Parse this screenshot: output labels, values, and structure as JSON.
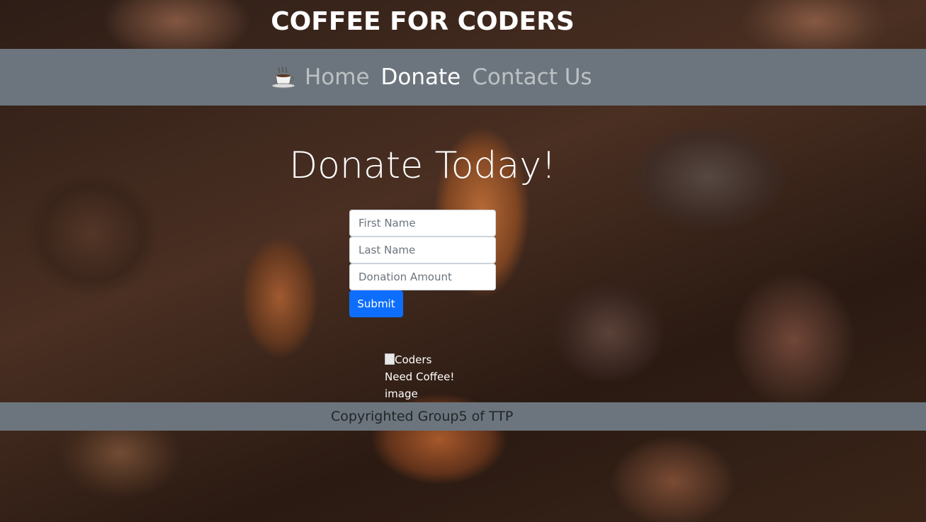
{
  "header": {
    "title": "COFFEE FOR CODERS"
  },
  "nav": {
    "brand_icon": "coffee-cup-icon",
    "links": [
      {
        "label": "Home",
        "active": false
      },
      {
        "label": "Donate",
        "active": true
      },
      {
        "label": "Contact Us",
        "active": false
      }
    ]
  },
  "main": {
    "heading": "Donate Today!",
    "form": {
      "first_name": {
        "value": "",
        "placeholder": "First Name"
      },
      "last_name": {
        "value": "",
        "placeholder": "Last Name"
      },
      "donation_amount": {
        "value": "",
        "placeholder": "Donation Amount"
      },
      "submit_label": "Submit"
    },
    "image": {
      "alt": "Coders Need Coffee! image"
    }
  },
  "footer": {
    "text": "Copyrighted Group5 of TTP"
  },
  "colors": {
    "navbar_bg": "#6c757d",
    "footer_bg": "#6c757d",
    "button_primary": "#0d6efd",
    "active_link": "#ffffff"
  }
}
